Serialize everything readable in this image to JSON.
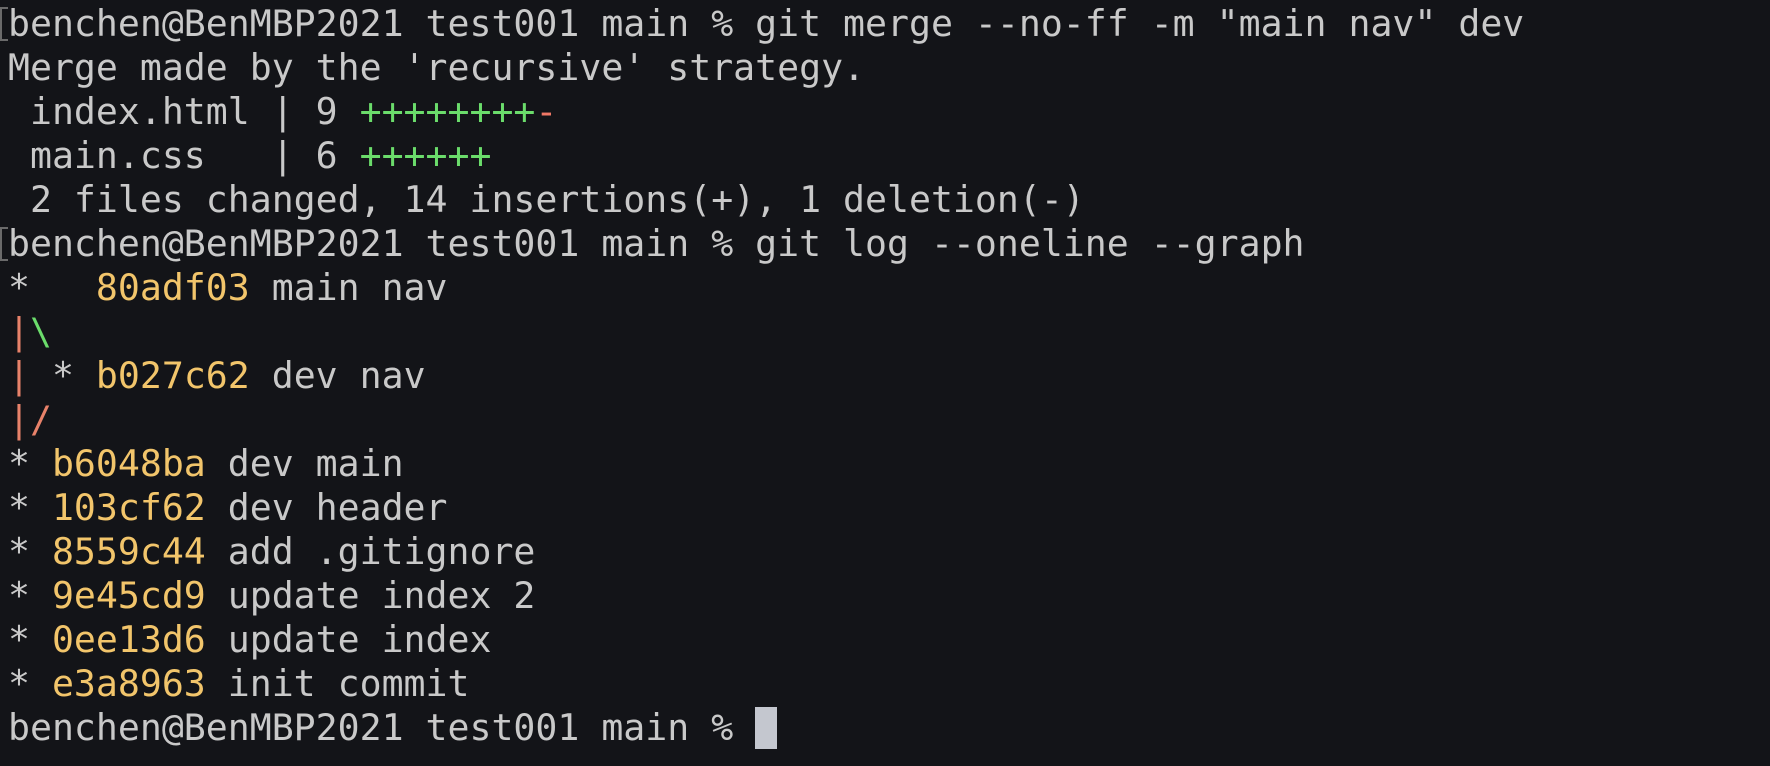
{
  "prompt": "benchen@BenMBP2021 test001 main % ",
  "commands": {
    "merge": "git merge --no-ff -m \"main nav\" dev",
    "log": "git log --oneline --graph"
  },
  "merge_output": {
    "message": "Merge made by the 'recursive' strategy.",
    "files": [
      {
        "name": " index.html | 9 ",
        "plus": "++++++++",
        "minus": "-"
      },
      {
        "name": " main.css   | 6 ",
        "plus": "++++++",
        "minus": ""
      }
    ],
    "summary": " 2 files changed, 14 insertions(+), 1 deletion(-)"
  },
  "log": {
    "merge_commit": {
      "graph": "*   ",
      "hash": "80adf03",
      "message": " main nav"
    },
    "branch_line": {
      "pipe": "|",
      "slash": "\\"
    },
    "dev_commit": {
      "pipe": "|",
      "graph": " * ",
      "hash": "b027c62",
      "message": " dev nav"
    },
    "join_line": "|/",
    "commits": [
      {
        "graph": "* ",
        "hash": "b6048ba",
        "message": " dev main"
      },
      {
        "graph": "* ",
        "hash": "103cf62",
        "message": " dev header"
      },
      {
        "graph": "* ",
        "hash": "8559c44",
        "message": " add .gitignore"
      },
      {
        "graph": "* ",
        "hash": "9e45cd9",
        "message": " update index 2"
      },
      {
        "graph": "* ",
        "hash": "0ee13d6",
        "message": " update index"
      },
      {
        "graph": "* ",
        "hash": "e3a8963",
        "message": " init commit"
      }
    ]
  },
  "colors": {
    "background": "#131418",
    "text": "#c9c9c9",
    "hash": "#f2c56b",
    "insertion": "#6bdc6b",
    "deletion": "#f07866",
    "cursor": "#c4c7cf"
  }
}
